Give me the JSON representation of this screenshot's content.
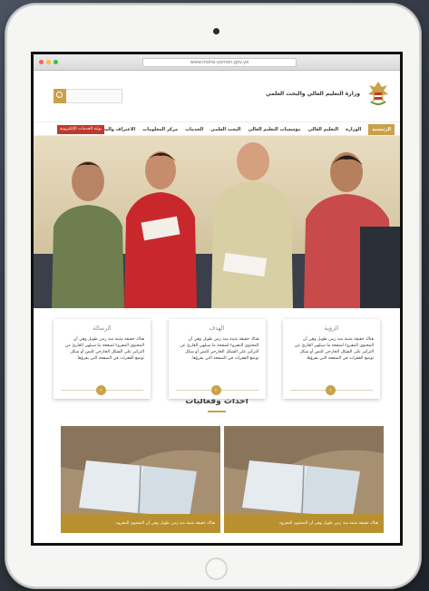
{
  "browser": {
    "url": "www.mohe-yemen.gov.ye"
  },
  "header": {
    "site_title": "وزارة التعليم العالي والبحث العلمي"
  },
  "nav": {
    "items": [
      "الرئيسية",
      "الوزارة",
      "التعليم العالي",
      "مؤسسات التعليم العالي",
      "البحث العلمي",
      "الخدمات",
      "مركز المعلومات",
      "الاعتراف والمعادلة"
    ],
    "cta": "بوابة الخدمات الإلكترونية"
  },
  "cards": [
    {
      "title": "الرؤية",
      "text": "هناك حقيقة مثبتة منذ زمن طويل وهي أن المحتوى المقروء لصفحة ما سيلهي القارئ عن التركيز على الشكل الخارجي للنص أو شكل توضع الفقرات في الصفحة التي يقرؤها."
    },
    {
      "title": "الهدف",
      "text": "هناك حقيقة مثبتة منذ زمن طويل وهي أن المحتوى المقروء لصفحة ما سيلهي القارئ عن التركيز على الشكل الخارجي للنص أو شكل توضع الفقرات في الصفحة التي يقرؤها."
    },
    {
      "title": "الرسالة",
      "text": "هناك حقيقة مثبتة منذ زمن طويل وهي أن المحتوى المقروء لصفحة ما سيلهي القارئ عن التركيز على الشكل الخارجي للنص أو شكل توضع الفقرات في الصفحة التي يقرؤها."
    }
  ],
  "news_section": {
    "title": "أحداث وفعاليات"
  },
  "news": [
    {
      "caption": "هناك حقيقة مثبتة منذ زمن طويل وهي أن المحتوى المقروء"
    },
    {
      "caption": "هناك حقيقة مثبتة منذ زمن طويل وهي أن المحتوى المقروء"
    }
  ],
  "colors": {
    "accent": "#c9a14a",
    "cta": "#c0392b",
    "caption": "#b8902f"
  }
}
